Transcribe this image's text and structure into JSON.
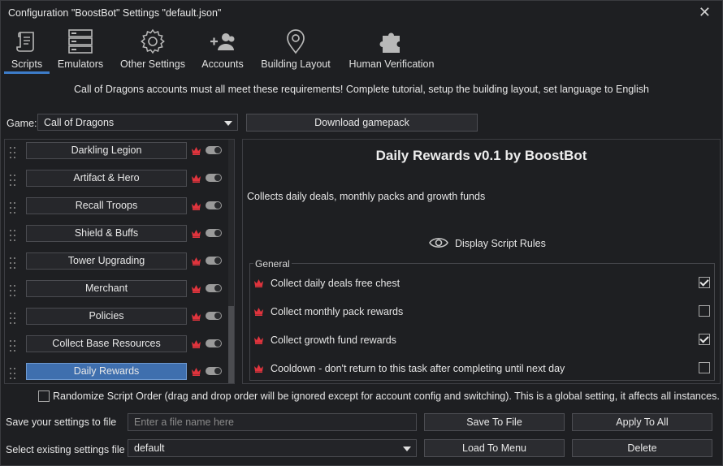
{
  "window": {
    "title": "Configuration \"BoostBot\" Settings \"default.json\"",
    "close_glyph": "✕"
  },
  "tabs": [
    {
      "label": "Scripts",
      "icon": "scroll-icon",
      "active": true
    },
    {
      "label": "Emulators",
      "icon": "server-icon"
    },
    {
      "label": "Other Settings",
      "icon": "gear-icon"
    },
    {
      "label": "Accounts",
      "icon": "users-add-icon"
    },
    {
      "label": "Building Layout",
      "icon": "map-pin-icon"
    },
    {
      "label": "Human Verification",
      "icon": "puzzle-icon"
    }
  ],
  "banner": "Call of Dragons accounts must all meet these requirements! Complete tutorial, setup the building layout, set language to English",
  "game": {
    "label": "Game:",
    "selected": "Call of Dragons",
    "download_label": "Download gamepack"
  },
  "scripts": [
    {
      "label": "Darkling Legion"
    },
    {
      "label": "Artifact & Hero"
    },
    {
      "label": "Recall Troops"
    },
    {
      "label": "Shield & Buffs"
    },
    {
      "label": "Tower Upgrading"
    },
    {
      "label": "Merchant"
    },
    {
      "label": "Policies"
    },
    {
      "label": "Collect Base Resources"
    },
    {
      "label": "Daily Rewards",
      "selected": true
    }
  ],
  "detail": {
    "title": "Daily Rewards v0.1 by BoostBot",
    "description": "Collects daily deals, monthly packs and growth funds",
    "rules_label": "Display Script Rules",
    "group_label": "General",
    "options": [
      {
        "label": "Collect daily deals free chest",
        "checked": true
      },
      {
        "label": "Collect monthly pack rewards",
        "checked": false
      },
      {
        "label": "Collect growth fund rewards",
        "checked": true
      },
      {
        "label": "Cooldown - don't return to this task after completing until next day",
        "checked": false
      }
    ]
  },
  "randomize": {
    "label": "Randomize Script Order (drag and drop order will be ignored except for account config and switching). This is a global setting, it affects all instances.",
    "checked": false
  },
  "save": {
    "label": "Save your settings to file",
    "placeholder": "Enter a file name here",
    "save_button": "Save To File",
    "apply_button": "Apply To All"
  },
  "load": {
    "label": "Select existing settings file",
    "selected": "default",
    "load_button": "Load To Menu",
    "delete_button": "Delete"
  },
  "colors": {
    "accent": "#3d7cc9",
    "crown": "#e0343d",
    "selected_script": "#3f6fae"
  }
}
